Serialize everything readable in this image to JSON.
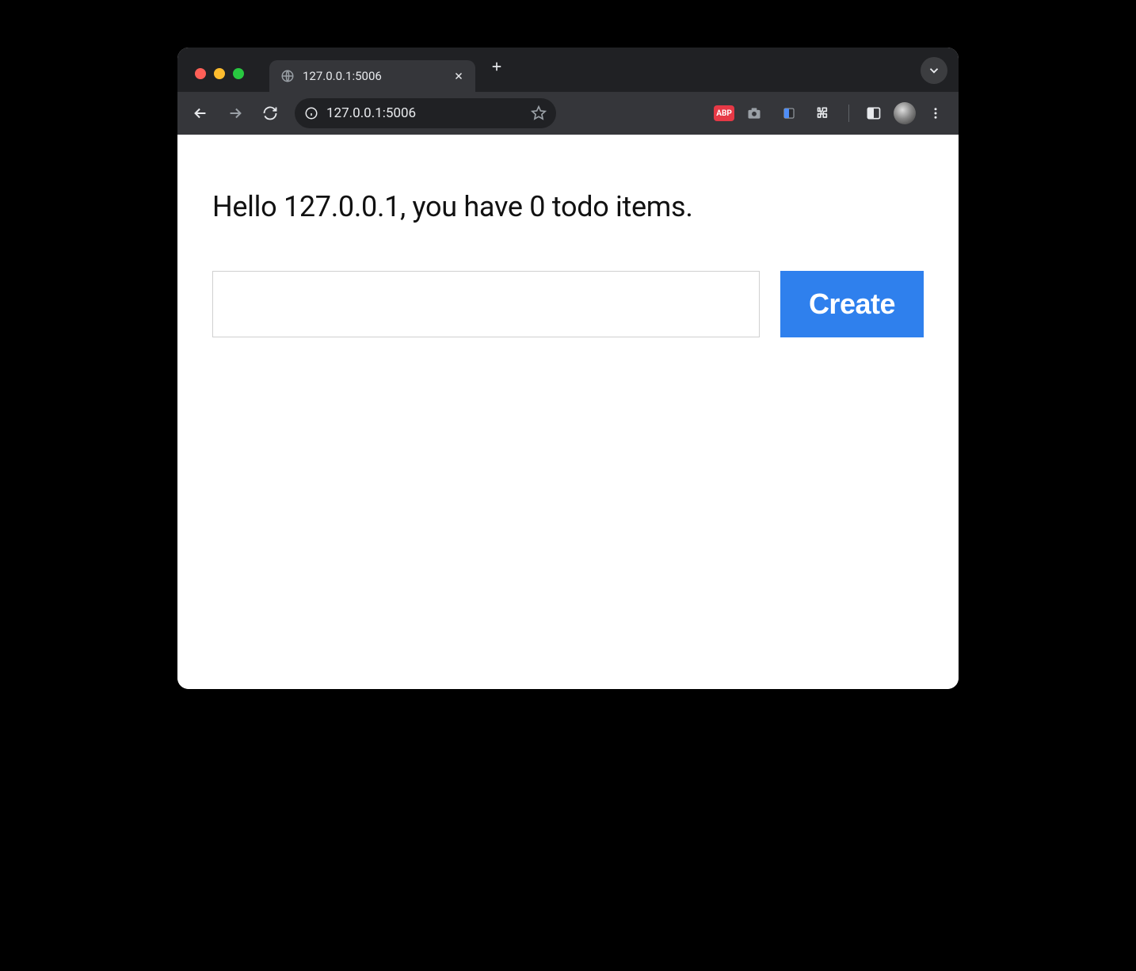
{
  "browser": {
    "tab": {
      "title": "127.0.0.1:5006"
    },
    "omnibox": {
      "url": "127.0.0.1:5006"
    },
    "extensions": {
      "abp_label": "ABP"
    }
  },
  "page": {
    "greeting": "Hello 127.0.0.1, you have 0 todo items.",
    "form": {
      "input_value": "",
      "create_label": "Create"
    }
  }
}
